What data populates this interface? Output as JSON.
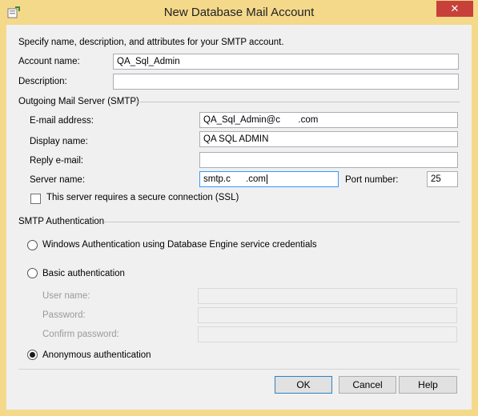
{
  "window": {
    "title": "New Database Mail Account",
    "close_glyph": "✕"
  },
  "intro": "Specify name, description, and attributes for your SMTP account.",
  "account": {
    "name_label": "Account name:",
    "name_value": "QA_Sql_Admin",
    "description_label": "Description:",
    "description_value": ""
  },
  "smtp": {
    "section_label": "Outgoing Mail Server (SMTP)",
    "email_label": "E-mail address:",
    "email_value": "QA_Sql_Admin@c       .com",
    "display_label": "Display name:",
    "display_value": "QA SQL ADMIN",
    "reply_label": "Reply e-mail:",
    "reply_value": "",
    "server_label": "Server name:",
    "server_value": "smtp.c      .com",
    "port_label": "Port number:",
    "port_value": "25",
    "ssl_label": "This server requires a secure connection (SSL)"
  },
  "auth": {
    "section_label": "SMTP Authentication",
    "windows_label": "Windows Authentication using Database Engine service credentials",
    "basic_label": "Basic authentication",
    "user_label": "User name:",
    "password_label": "Password:",
    "confirm_label": "Confirm password:",
    "anonymous_label": "Anonymous authentication",
    "selected": "anonymous"
  },
  "buttons": {
    "ok": "OK",
    "cancel": "Cancel",
    "help": "Help"
  }
}
